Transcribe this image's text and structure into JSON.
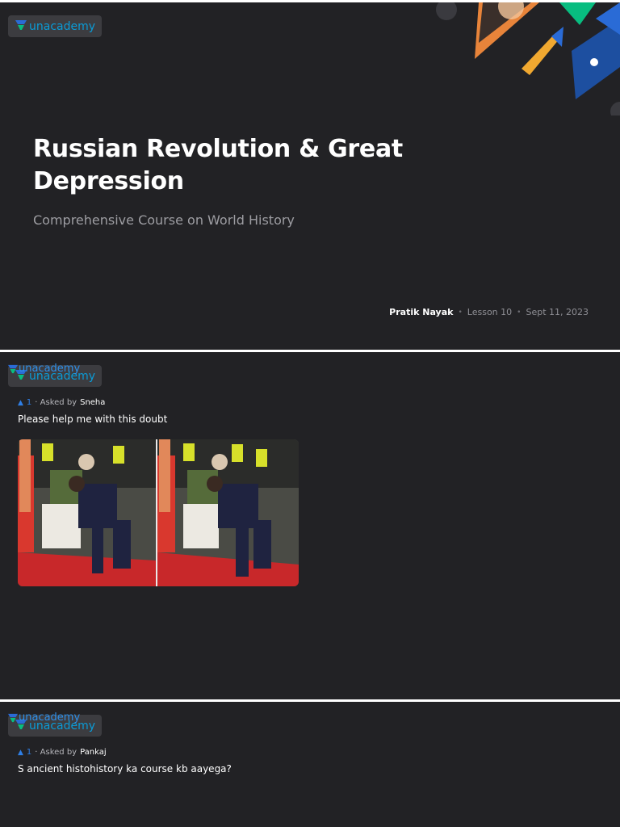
{
  "brand": {
    "logo_text": "unacademy"
  },
  "slide1": {
    "title": "Russian Revolution & Great Depression",
    "subtitle": "Comprehensive Course on World History",
    "author": "Pratik Nayak",
    "lesson": "Lesson 10",
    "date": "Sept 11, 2023"
  },
  "doubt1": {
    "upvotes": "1",
    "asked_by_label": "· Asked by",
    "asker": "Sneha",
    "question": "Please help me with this doubt",
    "image_icon": "photo-attachment"
  },
  "doubt2": {
    "upvotes": "1",
    "asked_by_label": "· Asked by",
    "asker": "Pankaj",
    "question": "S ancient histohistory ka course kb aayega?"
  },
  "colors": {
    "slide_bg": "#222225",
    "accent_blue": "#2f7fe6",
    "brand_green": "#08bd80",
    "text_muted": "#9d9da2"
  }
}
